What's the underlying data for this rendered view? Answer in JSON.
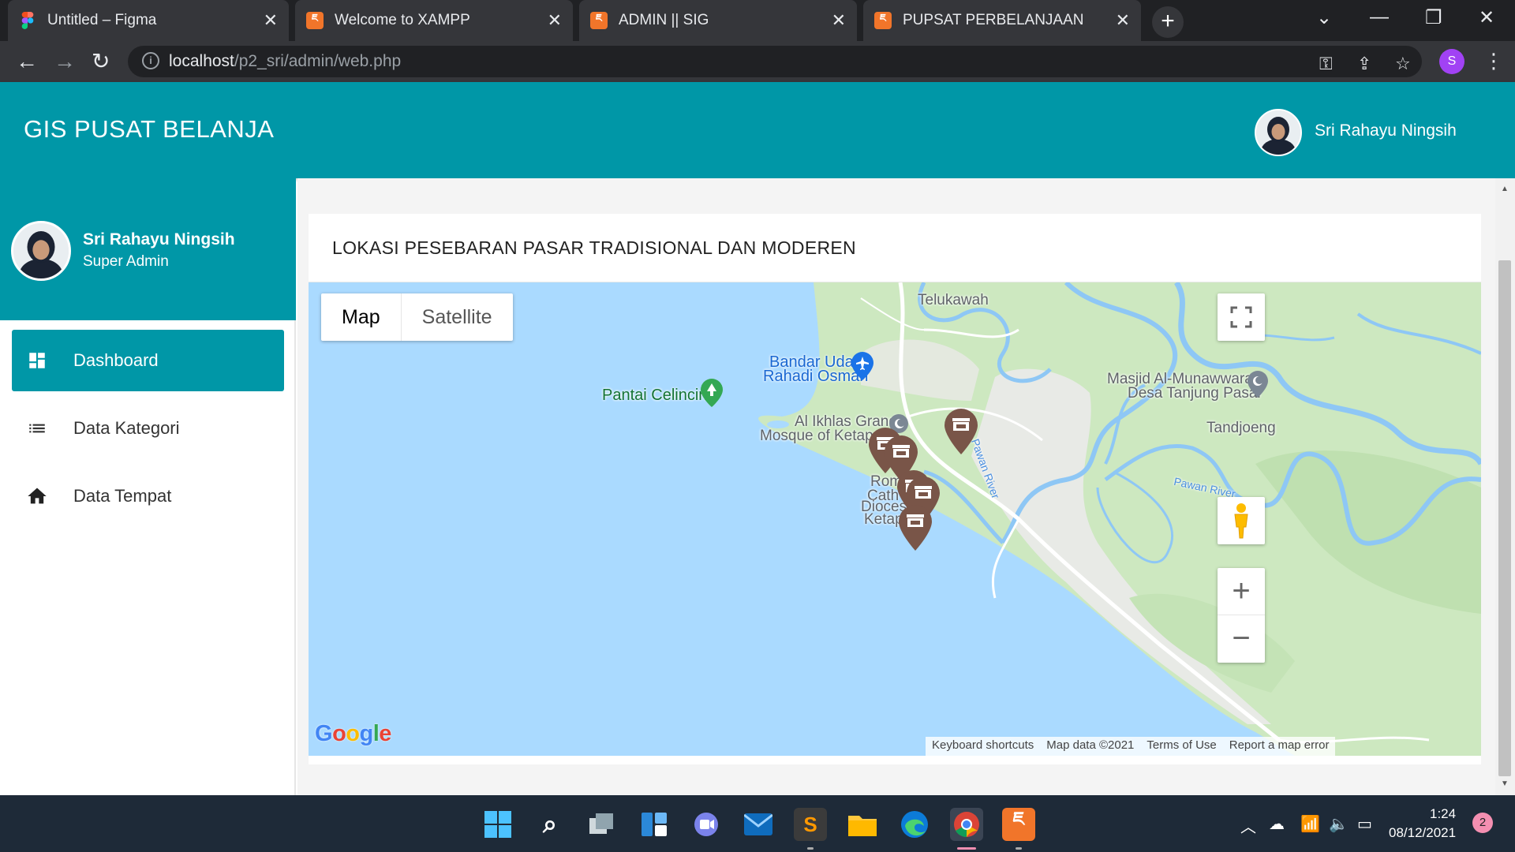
{
  "browser": {
    "tabs": [
      {
        "title": "Untitled – Figma",
        "favicon": "figma-icon"
      },
      {
        "title": "Welcome to XAMPP",
        "favicon": "xampp-icon"
      },
      {
        "title": "ADMIN || SIG",
        "favicon": "xampp-icon"
      },
      {
        "title": "PUPSAT PERBELANJAAN",
        "favicon": "xampp-icon",
        "active": true
      }
    ],
    "url_host": "localhost",
    "url_path": "/p2_sri/admin/web.php",
    "profile_initial": "S"
  },
  "header": {
    "app_title": "GIS PUSAT BELANJA",
    "user_name": "Sri Rahayu Ningsih",
    "brand_color": "#0097a7"
  },
  "sidebar": {
    "profile_name": "Sri Rahayu Ningsih",
    "profile_role": "Super Admin",
    "items": [
      {
        "label": "Dashboard",
        "icon": "dashboard-icon",
        "active": true
      },
      {
        "label": "Data Kategori",
        "icon": "list-icon"
      },
      {
        "label": "Data Tempat",
        "icon": "home-icon"
      }
    ]
  },
  "main": {
    "card_title": "LOKASI PESEBARAN PASAR TRADISIONAL DAN MODEREN",
    "map": {
      "map_types": [
        "Map",
        "Satellite"
      ],
      "selected_map_type": "Map",
      "places": {
        "telukawah": "Telukawah",
        "airport_line1": "Bandar Udara",
        "airport_line2": "Rahadi Osman",
        "beach": "Pantai Celincing",
        "mosque1_line1": "Al Ikhlas Grand",
        "mosque1_line2": "Mosque of Ketapang",
        "mosque2_line1": "Masjid Al-Munawwarah",
        "mosque2_line2": "Desa Tanjung Pasar",
        "tandjoeng": "Tandjoeng",
        "rom1": "Rom",
        "rom2": "Cath",
        "rom3": "Diocese",
        "rom4": "Ketapa",
        "river1": "Pawan River",
        "river2": "Pawan River"
      },
      "marker_count": 6,
      "attribution": [
        "Keyboard shortcuts",
        "Map data ©2021",
        "Terms of Use",
        "Report a map error"
      ],
      "zoom_in": "+",
      "zoom_out": "−"
    }
  },
  "taskbar": {
    "time": "1:24",
    "date": "08/12/2021",
    "notifications": "2"
  }
}
